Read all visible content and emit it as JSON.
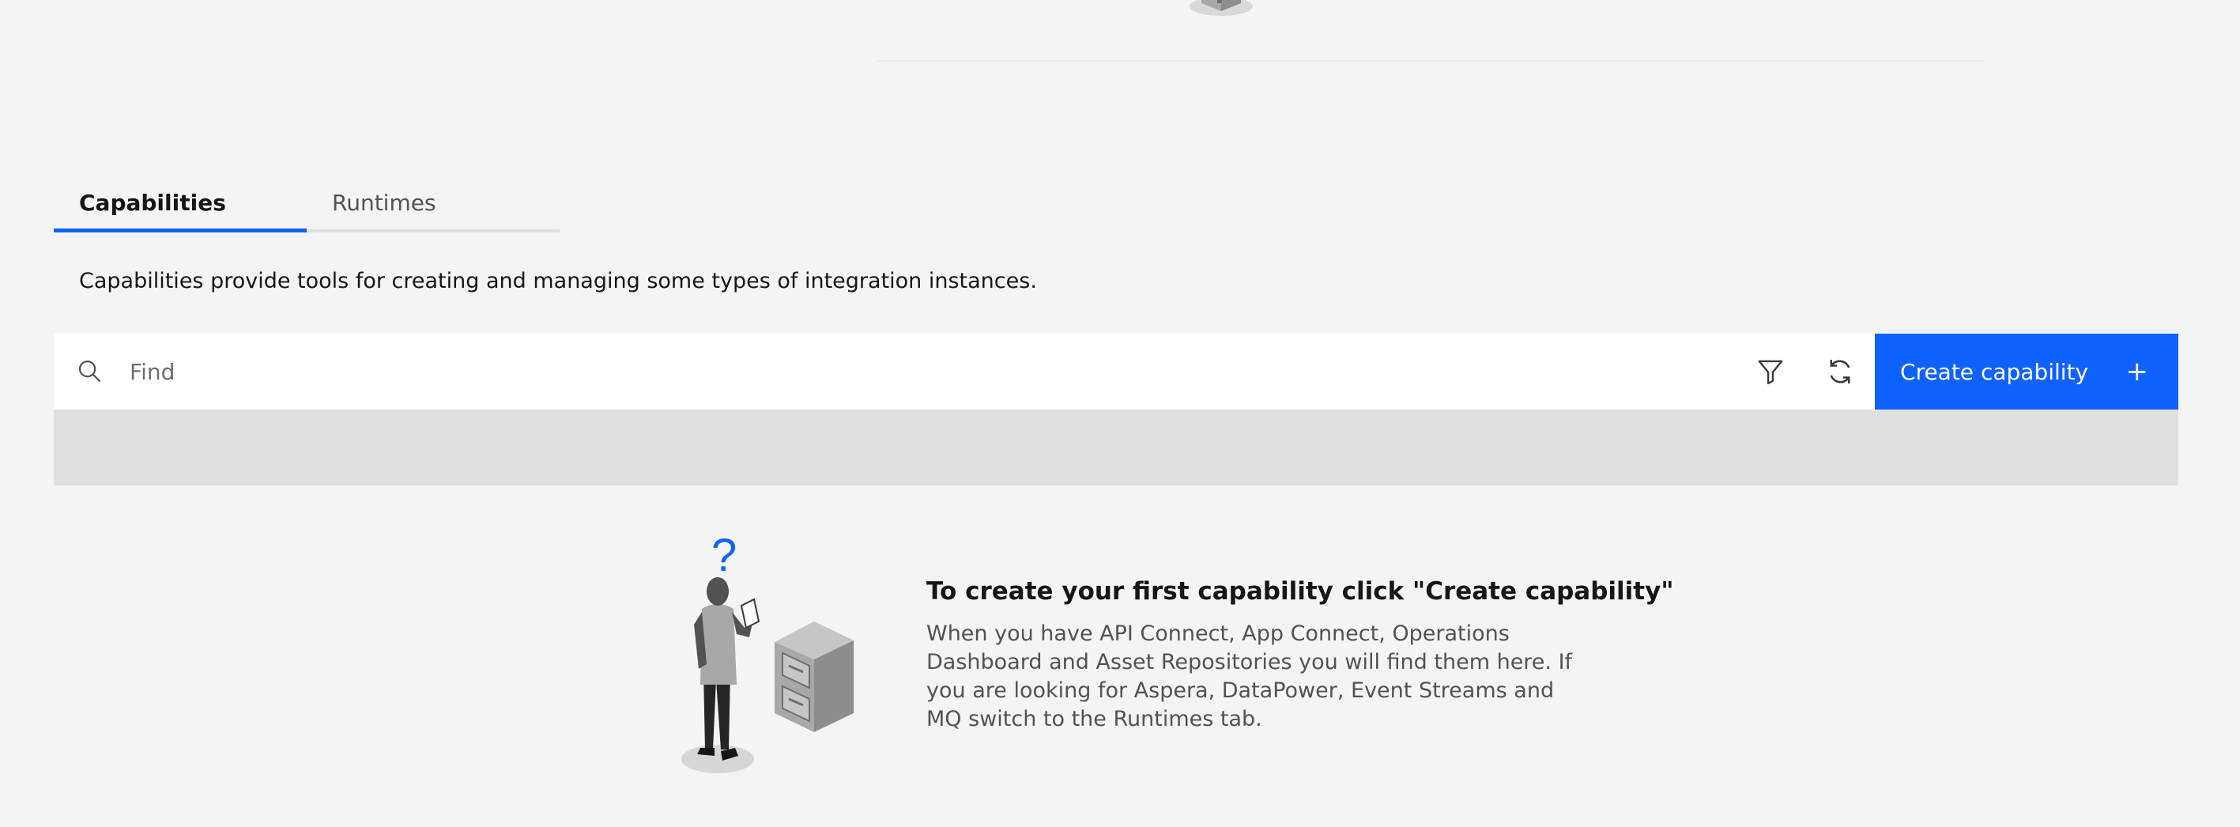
{
  "tabs": [
    {
      "label": "Capabilities",
      "active": true
    },
    {
      "label": "Runtimes",
      "active": false
    }
  ],
  "description": "Capabilities provide tools for creating and managing some types of integration instances.",
  "toolbar": {
    "search_placeholder": "Find",
    "search_icon": "search-icon",
    "filter_icon": "filter-icon",
    "refresh_icon": "refresh-icon",
    "create_label": "Create capability",
    "create_icon": "plus-icon"
  },
  "empty_state": {
    "question_mark": "?",
    "title": "To create your first capability click \"Create capability\"",
    "body": "When you have API Connect, App Connect, Operations Dashboard and Asset Repositories you will find them here. If you are looking for Aspera, DataPower, Event Streams and MQ switch to the Runtimes tab."
  },
  "colors": {
    "primary": "#0f62fe",
    "background": "#f4f4f4",
    "toolbar": "#ffffff",
    "table_header": "#e0e0e0"
  }
}
